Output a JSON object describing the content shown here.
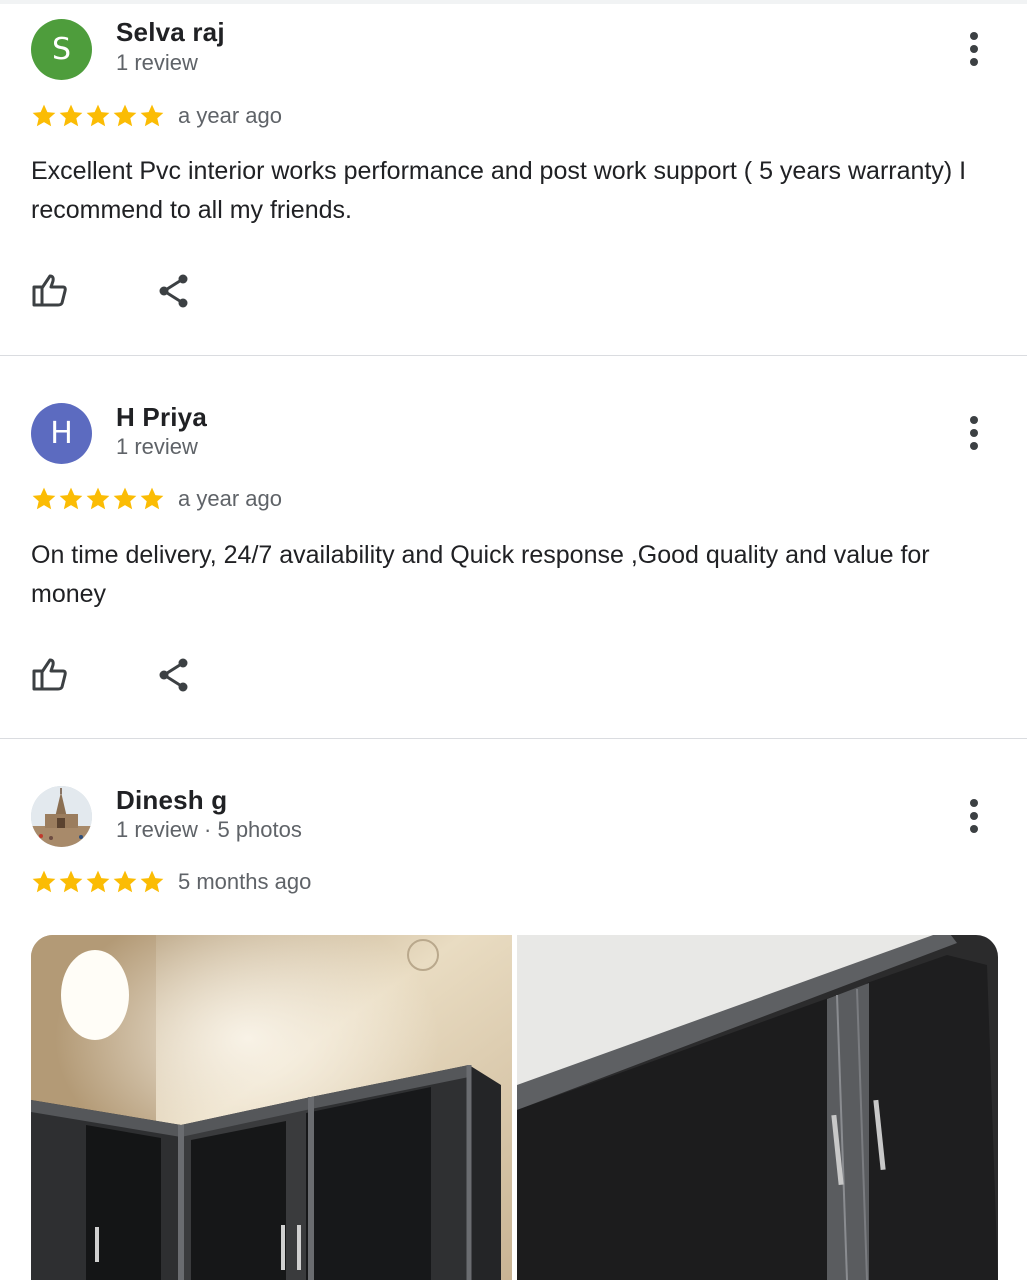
{
  "reviews": [
    {
      "avatar_letter": "S",
      "avatar_color": "#4e9d3c",
      "name": "Selva raj",
      "meta": "1 review",
      "rating": 5,
      "time": "a year ago",
      "text": "Excellent Pvc interior works performance and post work support ( 5 years warranty) I recommend to all my friends."
    },
    {
      "avatar_letter": "H",
      "avatar_color": "#5c6bc0",
      "name": "H Priya",
      "meta": "1 review",
      "rating": 5,
      "time": "a year ago",
      "text": "On time delivery, 24/7 availability and Quick response ,Good quality and value for money"
    },
    {
      "avatar_letter": "",
      "avatar_color": "#cfd8dc",
      "name": "Dinesh g",
      "meta": "1 review · 5 photos",
      "rating": 5,
      "time": "5 months ago",
      "text": ""
    }
  ],
  "icons": {
    "more": "more-vert-icon",
    "like": "thumb-up-icon",
    "share": "share-icon",
    "star": "star-icon"
  },
  "colors": {
    "star": "#fbbc04",
    "secondary_text": "#5f6368",
    "icon": "#3c4043"
  }
}
